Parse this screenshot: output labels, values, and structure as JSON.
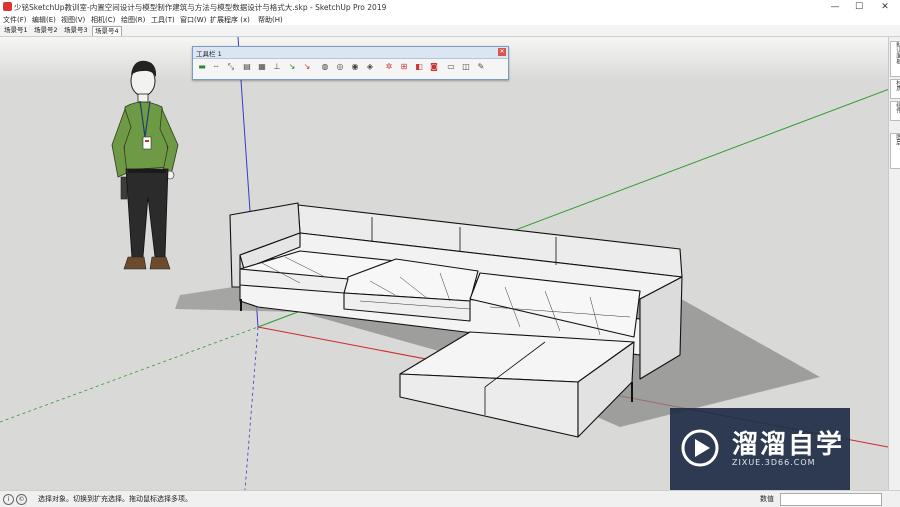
{
  "window": {
    "title": "少铭SketchUp教训室-内置空间设计与模型制作建筑与方法与模型数据设计与格式大.skp - SketchUp Pro 2019",
    "minimize": "—",
    "maximize": "☐",
    "close": "✕"
  },
  "menu": [
    "文件(F)",
    "编辑(E)",
    "视图(V)",
    "相机(C)",
    "绘图(R)",
    "工具(T)",
    "窗口(W)",
    "扩展程序 (x)",
    "帮助(H)"
  ],
  "scenes": [
    {
      "label": "场景号1",
      "active": false
    },
    {
      "label": "场景号2",
      "active": false
    },
    {
      "label": "场景号3",
      "active": false
    },
    {
      "label": "场景号4",
      "active": true
    }
  ],
  "toolbar": {
    "title": "工具栏 1",
    "close": "✕",
    "icons": [
      "line-icon",
      "dash-icon",
      "scale-icon",
      "section-icon",
      "table-icon",
      "dimension-icon",
      "axis-icon",
      "axes-alt-icon",
      "sphere-icon",
      "sphere-alt-icon",
      "camera-icon",
      "render-icon",
      "gear-icon",
      "grid-icon",
      "folder-red-icon",
      "camera-red-icon",
      "folder-icon",
      "folder-open-icon",
      "pen-icon"
    ]
  },
  "right_panel": {
    "tabs": [
      "默认面板",
      "材质",
      "组件",
      "图层"
    ]
  },
  "status": {
    "text": "选择对象。切换到扩充选择。拖动鼠标选择多项。",
    "measure_label": "数值"
  },
  "watermark": {
    "title": "溜溜自学",
    "url": "ZIXUE.3D66.COM"
  }
}
